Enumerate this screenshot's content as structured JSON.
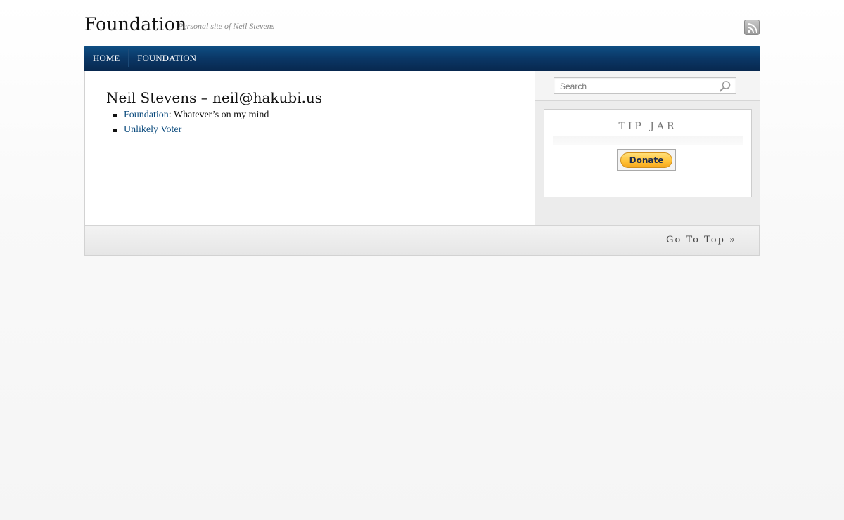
{
  "header": {
    "site_title": "Foundation",
    "tagline": "Personal site of Neil Stevens",
    "rss_icon": "rss-feed-icon"
  },
  "nav": {
    "items": [
      {
        "label": "HOME"
      },
      {
        "label": "FOUNDATION"
      }
    ]
  },
  "main": {
    "heading": "Neil Stevens – neil@hakubi.us",
    "list": [
      {
        "link": "Foundation",
        "text": ": Whatever’s on my mind"
      },
      {
        "link": "Unlikely Voter",
        "text": ""
      }
    ]
  },
  "sidebar": {
    "search": {
      "placeholder": "Search",
      "icon": "magnifier-icon"
    },
    "widget": {
      "title": "TIP JAR",
      "donate_label": "Donate"
    }
  },
  "footer": {
    "go_top": "Go To Top »"
  },
  "colors": {
    "nav_bg": "#0a3766",
    "link": "#0d4c7e",
    "donate": "#ffc33a"
  }
}
